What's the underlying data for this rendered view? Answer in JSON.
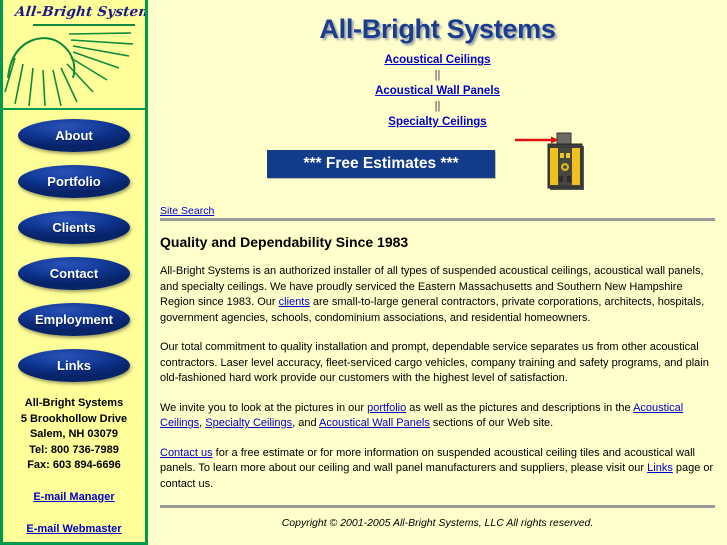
{
  "sidebar": {
    "logo": {
      "wordmark": "All-Bright Systems",
      "icon": "sunburst-icon",
      "sun_color": "#0f8a3c",
      "wordmark_color": "#1a1a8c"
    },
    "nav_buttons": [
      {
        "label": "About"
      },
      {
        "label": "Portfolio"
      },
      {
        "label": "Clients"
      },
      {
        "label": "Contact"
      },
      {
        "label": "Employment"
      },
      {
        "label": "Links"
      }
    ],
    "address": {
      "company": "All-Bright Systems",
      "street": "5 Brookhollow Drive",
      "city_state_zip": "Salem, NH 03079",
      "tel": "Tel: 800 736-7989",
      "fax": "Fax: 603 894-6696"
    },
    "email_manager": "E-mail Manager",
    "email_webmaster": "E-mail Webmaster",
    "background": "#ffff99",
    "border_color": "#00994d"
  },
  "main": {
    "title": "All-Bright Systems",
    "section_links": [
      {
        "label": "Acoustical Ceilings"
      },
      {
        "label": "Acoustical Wall Panels"
      },
      {
        "label": "Specialty Ceilings"
      }
    ],
    "separator": "||",
    "free_estimates": "*** Free Estimates ***",
    "free_estimates_bg": "#123b8a",
    "laser_level_icon": "laser-level-icon",
    "site_search": "Site Search",
    "heading": "Quality and Dependability Since 1983",
    "paragraph1": {
      "part1": "All-Bright Systems is an authorized installer of all types of suspended acoustical ceilings, acoustical wall panels, and specialty ceilings. We have proudly serviced the Eastern Massachusetts and Southern New Hampshire Region since 1983. Our ",
      "link1": "clients",
      "part2": " are small-to-large general contractors, private corporations, architects, hospitals, government agencies, schools, condominium associations, and residential homeowners."
    },
    "paragraph2": "Our total commitment to quality installation and prompt, dependable service separates us from other acoustical contractors. Laser level accuracy, fleet-serviced cargo vehicles, company training and safety programs, and plain old-fashioned hard work provide our customers with the highest level of satisfaction.",
    "paragraph3": {
      "part1": "We invite you to look at the pictures in our ",
      "link1": "portfolio",
      "part2": " as well as the pictures and descriptions in the ",
      "link2": "Acoustical Ceilings",
      "part3": ", ",
      "link3": "Specialty Ceilings",
      "part4": ", and ",
      "link4": "Acoustical Wall Panels",
      "part5": " sections of our Web site."
    },
    "paragraph4": {
      "link1": "Contact us",
      "part1": " for a free estimate or for more information on suspended acoustical ceiling tiles and acoustical wall panels. To learn more about our ceiling and wall panel manufacturers and suppliers, please visit our ",
      "link2": "Links",
      "part2": " page or contact us."
    },
    "copyright": "Copyright © 2001-2005 All-Bright Systems, LLC   All rights reserved.",
    "link_color": "#0000cc",
    "background": "#ffffcc"
  }
}
